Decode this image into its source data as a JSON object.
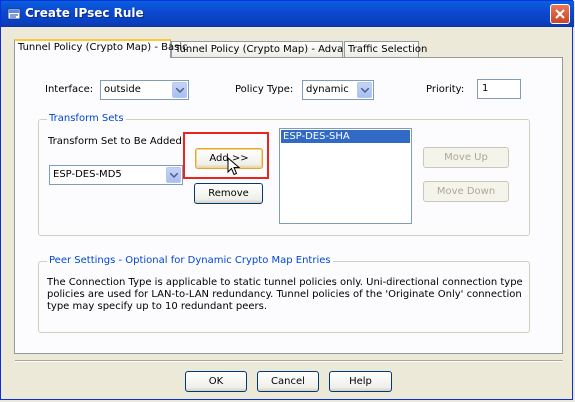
{
  "window": {
    "title": "Create IPsec Rule"
  },
  "tabs": [
    {
      "label": "Tunnel Policy (Crypto Map) - Basic",
      "active": true
    },
    {
      "label": "Tunnel Policy (Crypto Map) - Advanced",
      "active": false
    },
    {
      "label": "Traffic Selection",
      "active": false
    }
  ],
  "form": {
    "interface_label": "Interface:",
    "interface_value": "outside",
    "policy_type_label": "Policy Type:",
    "policy_type_value": "dynamic",
    "priority_label": "Priority:",
    "priority_value": "1"
  },
  "transform_sets": {
    "group_title": "Transform Sets",
    "to_add_label": "Transform Set to Be Added:",
    "to_add_value": "ESP-DES-MD5",
    "add_label": "Add >>",
    "remove_label": "Remove",
    "selected_items": [
      "ESP-DES-SHA"
    ],
    "move_up_label": "Move Up",
    "move_down_label": "Move Down"
  },
  "peer_settings": {
    "group_title": "Peer Settings  -  Optional for Dynamic Crypto Map Entries",
    "description": "The Connection Type is applicable to static tunnel policies only. Uni-directional connection type policies are used for LAN-to-LAN redundancy. Tunnel policies of the 'Originate Only' connection type may specify up to 10 redundant peers."
  },
  "footer": {
    "ok_label": "OK",
    "cancel_label": "Cancel",
    "help_label": "Help"
  },
  "colors": {
    "accent": "#0046d5",
    "highlight": "#e8251f",
    "selection": "#316ac5"
  }
}
